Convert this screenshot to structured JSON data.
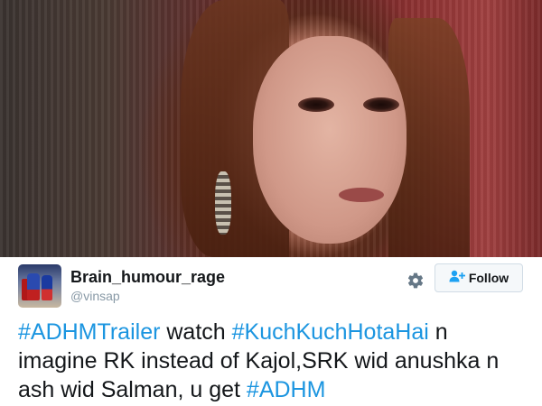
{
  "tweet": {
    "user": {
      "display_name": "Brain_humour_rage",
      "handle": "@vinsap"
    },
    "follow_label": "Follow",
    "text_parts": [
      {
        "text": "#ADHMTrailer",
        "type": "hashtag"
      },
      {
        "text": " watch ",
        "type": "text"
      },
      {
        "text": "#KuchKuchHotaHai",
        "type": "hashtag"
      },
      {
        "text": " n imagine RK instead of Kajol,SRK wid anushka n ash wid Salman, u get ",
        "type": "text"
      },
      {
        "text": "#ADHM",
        "type": "hashtag"
      }
    ]
  },
  "icons": {
    "settings": "gear-icon",
    "follow": "add-user-icon"
  },
  "colors": {
    "hashtag": "#1b95e0",
    "handle": "#8899a6",
    "follow_icon": "#1da1f2"
  }
}
